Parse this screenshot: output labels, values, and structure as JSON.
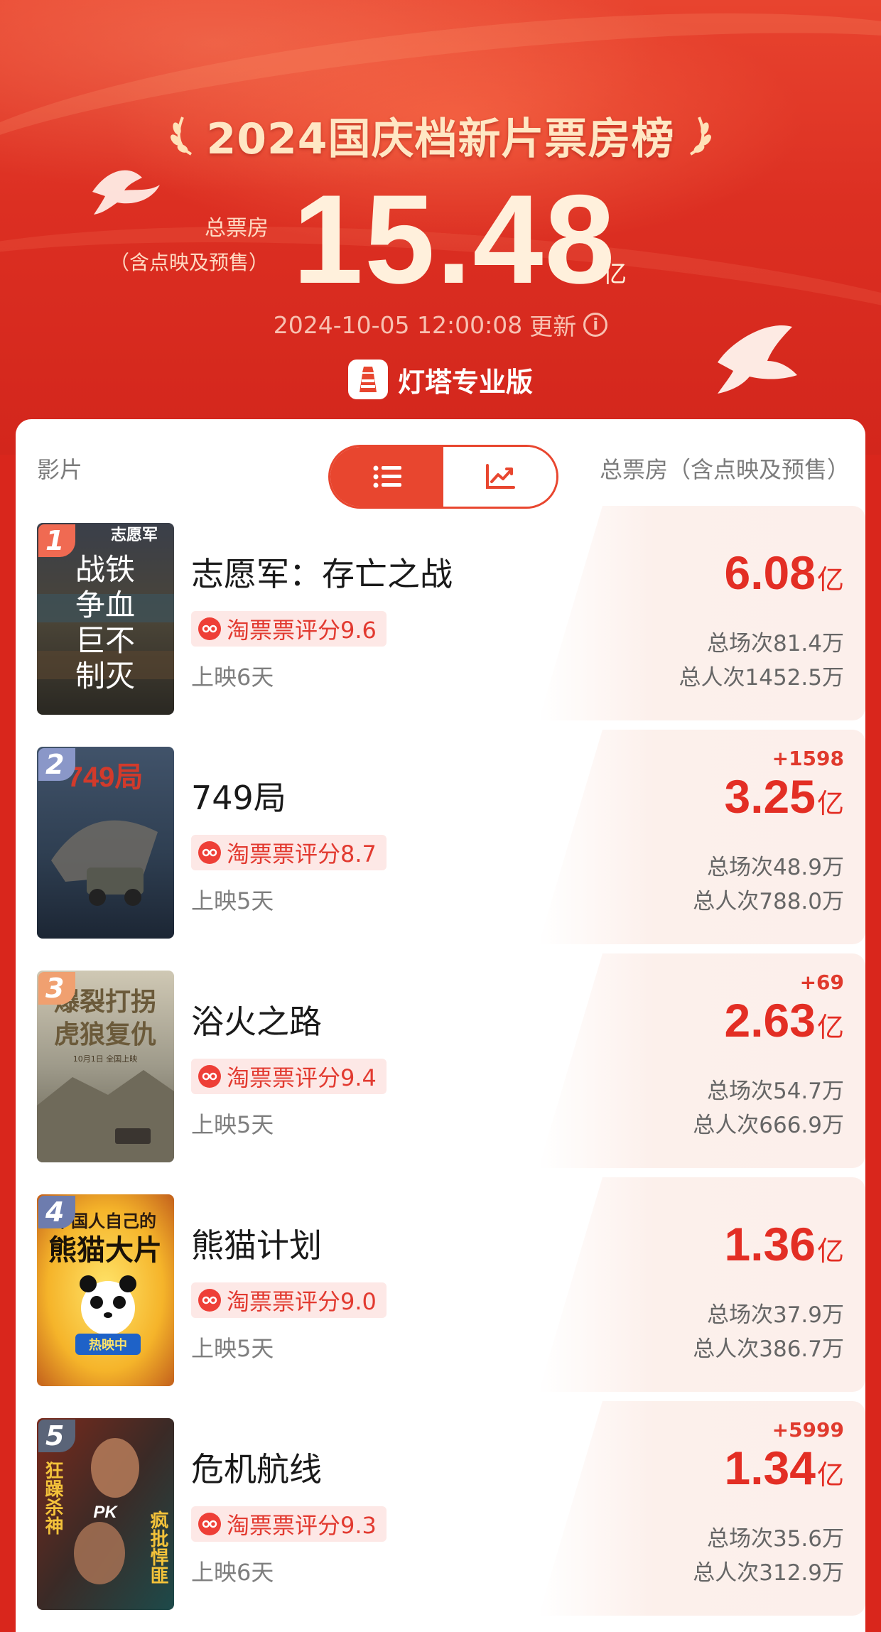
{
  "header": {
    "title": "2024国庆档新片票房榜",
    "total_label": "总票房",
    "total_sub": "（含点映及预售）",
    "total_value": "15.48",
    "total_unit": "亿",
    "update_time": "2024-10-05 12:00:08",
    "update_label": "更新",
    "brand": "灯塔专业版"
  },
  "table_header": {
    "film_label": "影片",
    "box_label": "总票房（含点映及预售）"
  },
  "colors": {
    "accent": "#e8462f",
    "gross_red": "#e32e24",
    "score_bg": "#fde8e6"
  },
  "movies": [
    {
      "rank": "1",
      "name": "志愿军：存亡之战",
      "score": "淘票票评分9.6",
      "days": "上映6天",
      "delta": "",
      "gross": "6.08",
      "unit": "亿",
      "shows": "总场次81.4万",
      "people": "总人次1452.5万"
    },
    {
      "rank": "2",
      "name": "749局",
      "score": "淘票票评分8.7",
      "days": "上映5天",
      "delta": "+1598",
      "gross": "3.25",
      "unit": "亿",
      "shows": "总场次48.9万",
      "people": "总人次788.0万"
    },
    {
      "rank": "3",
      "name": "浴火之路",
      "score": "淘票票评分9.4",
      "days": "上映5天",
      "delta": "+69",
      "gross": "2.63",
      "unit": "亿",
      "shows": "总场次54.7万",
      "people": "总人次666.9万"
    },
    {
      "rank": "4",
      "name": "熊猫计划",
      "score": "淘票票评分9.0",
      "days": "上映5天",
      "delta": "",
      "gross": "1.36",
      "unit": "亿",
      "shows": "总场次37.9万",
      "people": "总人次386.7万"
    },
    {
      "rank": "5",
      "name": "危机航线",
      "score": "淘票票评分9.3",
      "days": "上映6天",
      "delta": "+5999",
      "gross": "1.34",
      "unit": "亿",
      "shows": "总场次35.6万",
      "people": "总人次312.9万"
    }
  ],
  "posters": {
    "p1": {
      "top": "志愿军",
      "lines": [
        "战铁",
        "争血",
        "巨不",
        "制灭"
      ]
    },
    "p2": {
      "logo": "749局"
    },
    "p3": {
      "lines": [
        "爆裂打拐",
        "虎狼复仇"
      ],
      "sub": "10月1日 全国上映"
    },
    "p4": {
      "lines": [
        "中国人自己的",
        "熊猫大片"
      ],
      "badge": "热映中"
    },
    "p5": {
      "left": "狂躁杀神",
      "right": "疯批悍匪",
      "mid": "PK"
    }
  }
}
